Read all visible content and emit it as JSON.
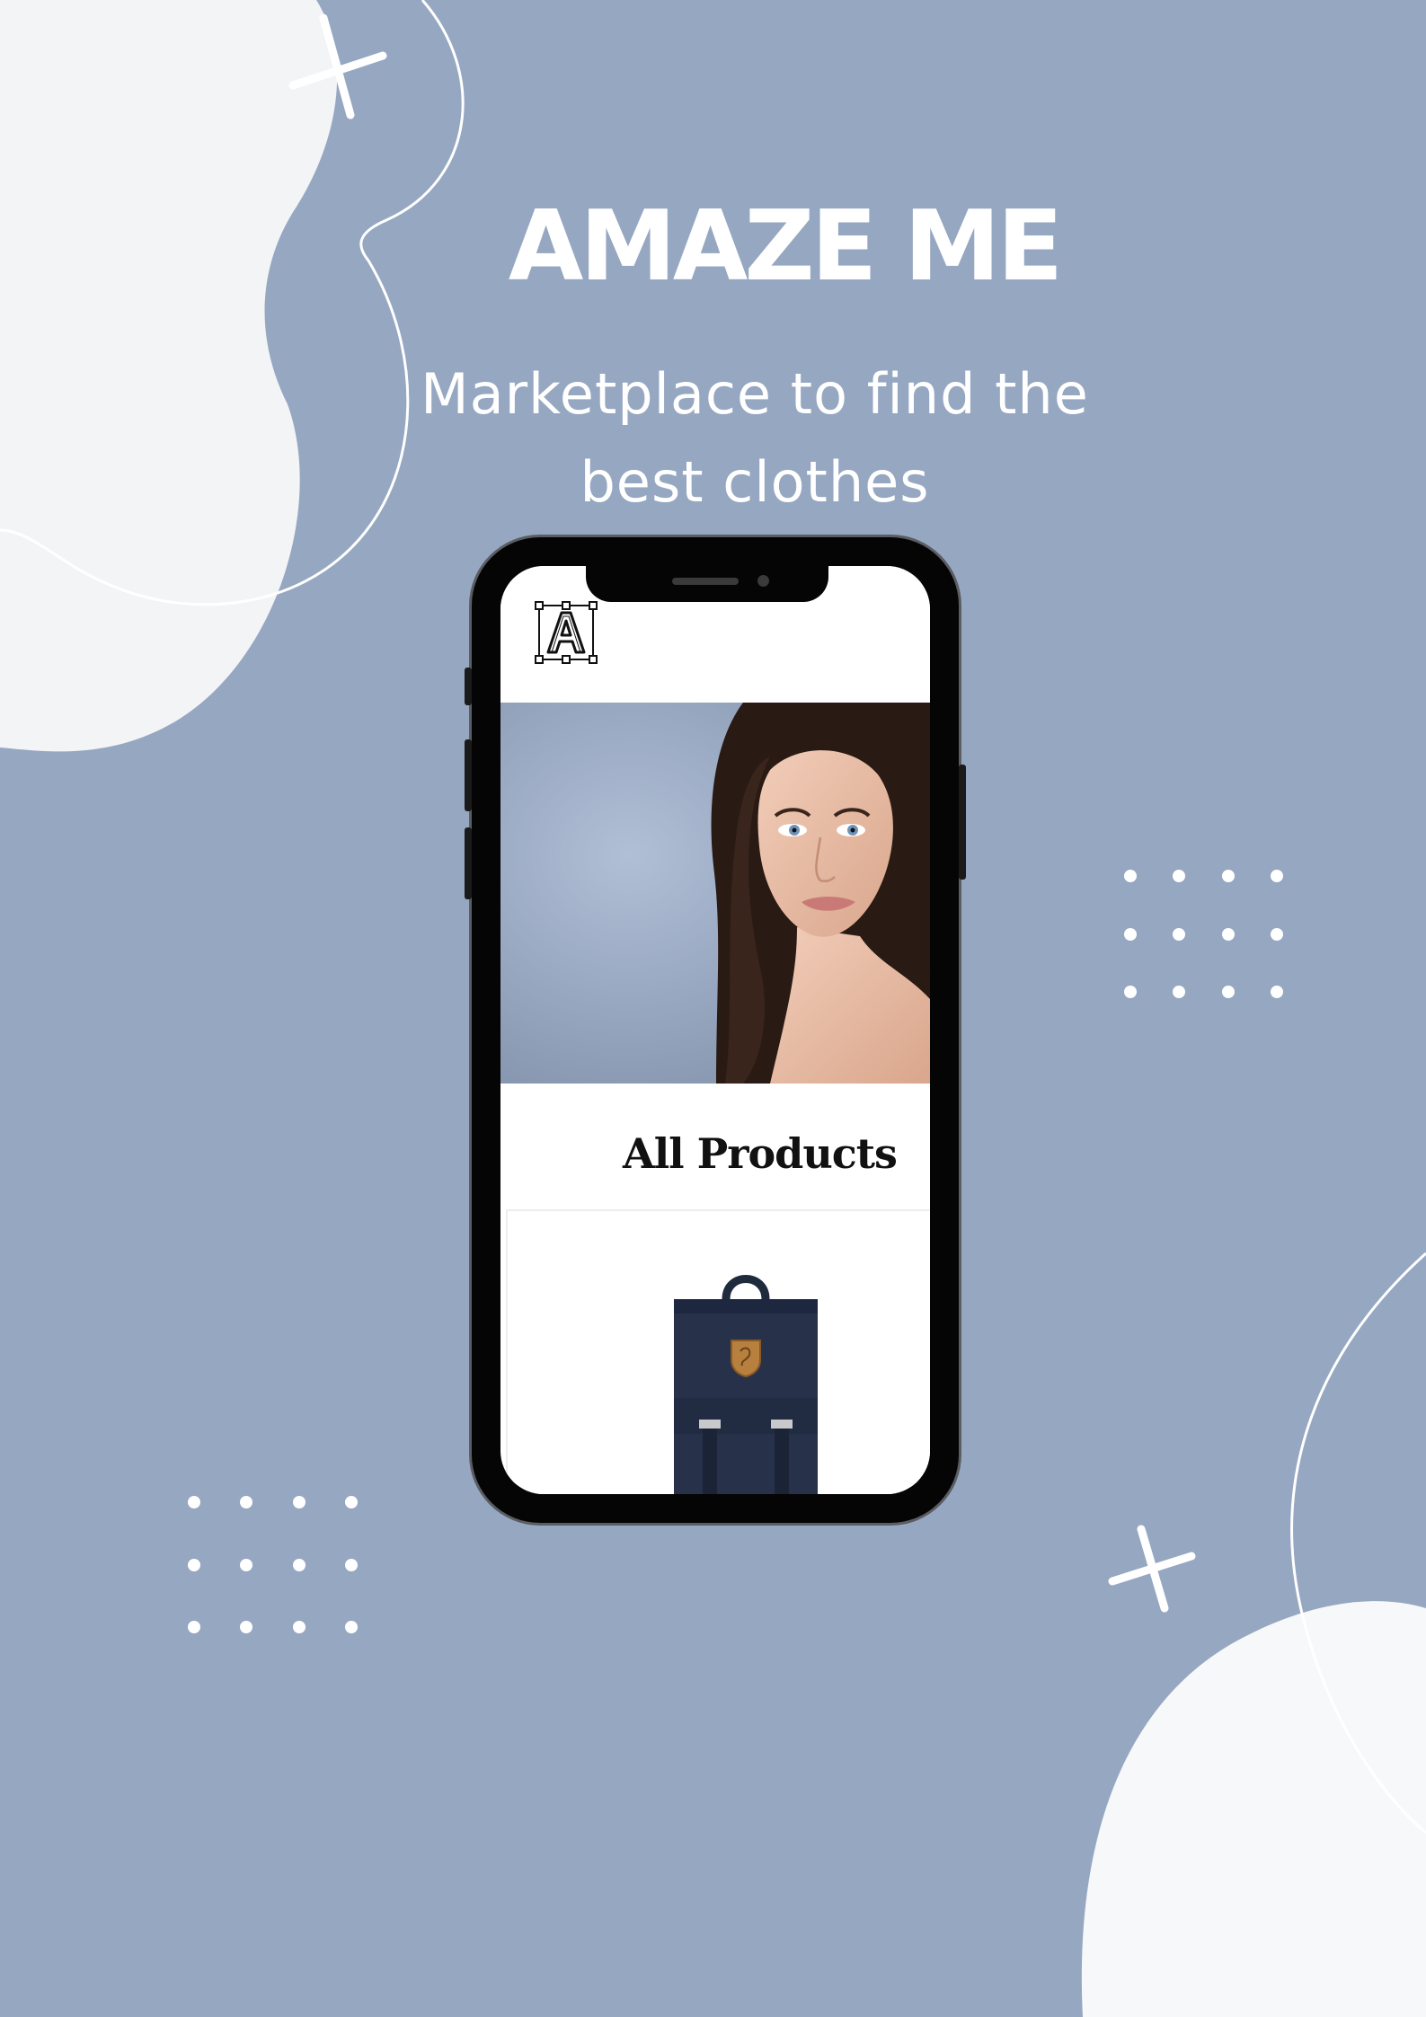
{
  "poster": {
    "headline": "AMAZE ME",
    "subtitle": "Marketplace to find the best clothes"
  },
  "app": {
    "logo_letter": "A",
    "section_title": "All Products"
  },
  "colors": {
    "background": "#96a7c1",
    "blob": "#f3f4f6",
    "phone_frame": "#050505"
  },
  "icons": {
    "logo": "letter-a-logo-icon",
    "hero": "model-portrait-photo",
    "product": "backpack-product-photo"
  }
}
